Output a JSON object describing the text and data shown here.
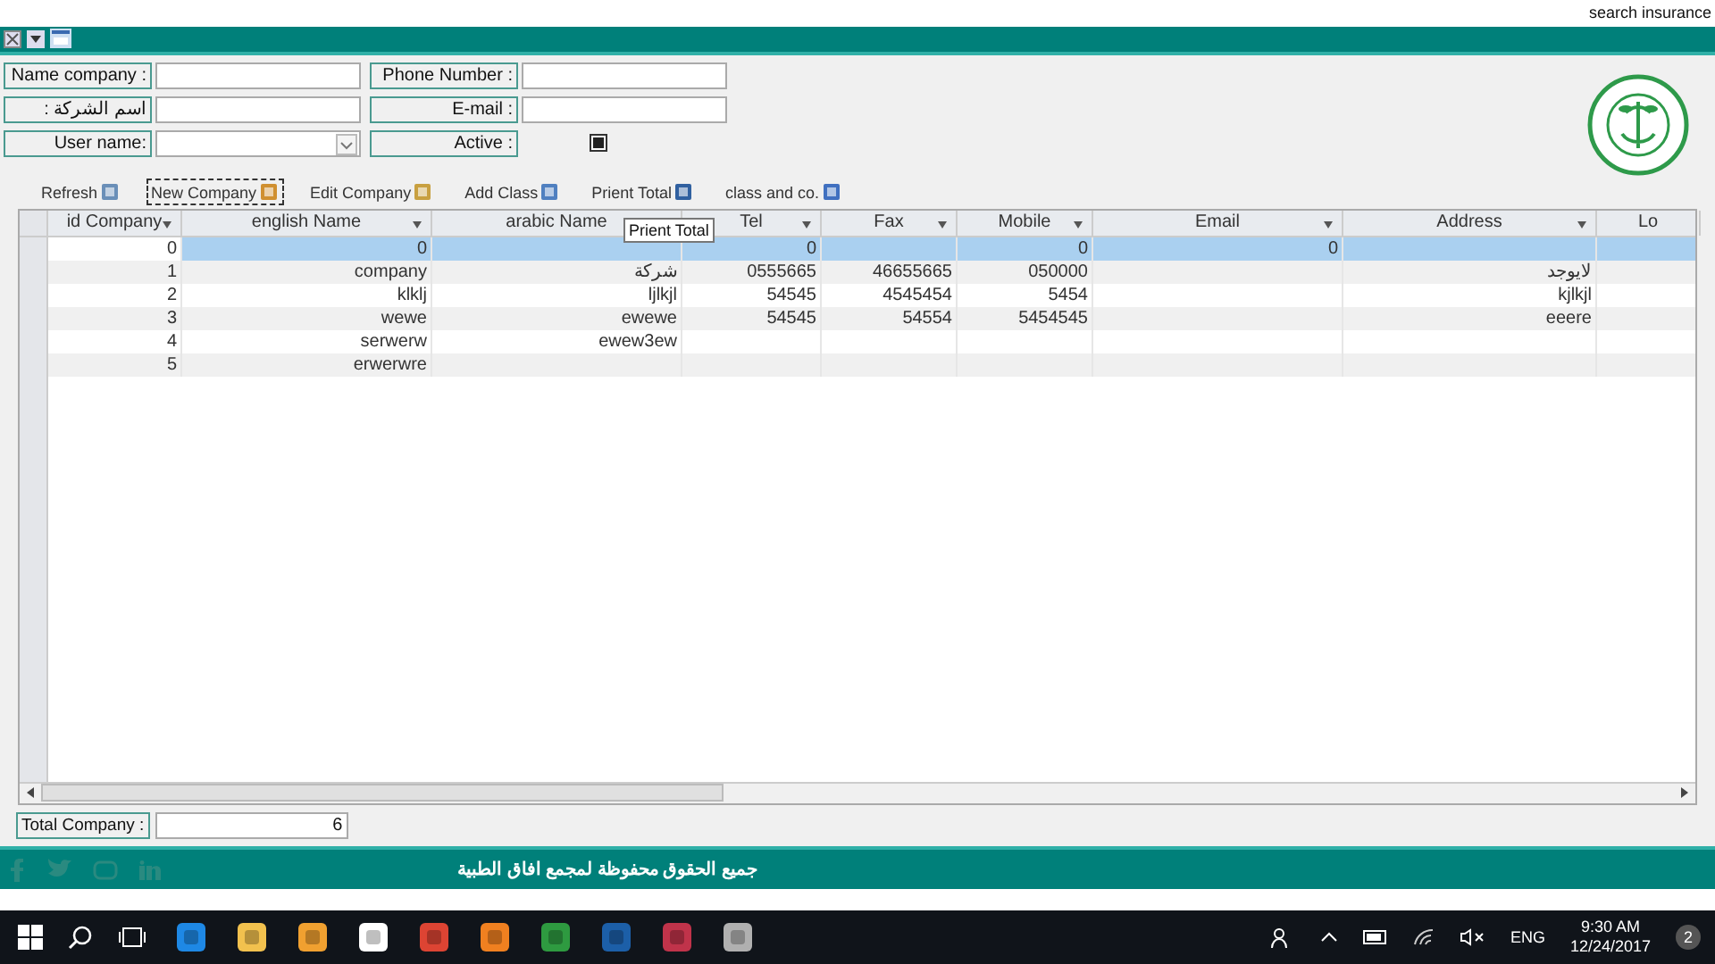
{
  "top_link": "search insurance",
  "form": {
    "fields": [
      {
        "label": "Name company :",
        "kind": "text"
      },
      {
        "label": "Phone Number :",
        "kind": "text"
      },
      {
        "label": ": اسم الشركة",
        "kind": "text"
      },
      {
        "label": "E-mail :",
        "kind": "text"
      },
      {
        "label": "User name:",
        "kind": "combo"
      },
      {
        "label": "Active :",
        "kind": "check",
        "checked": true
      }
    ]
  },
  "toolbar": [
    {
      "label": "Refresh",
      "focused": false
    },
    {
      "label": "New Company",
      "focused": true
    },
    {
      "label": "Edit Company",
      "focused": false
    },
    {
      "label": "Add Class",
      "focused": false
    },
    {
      "label": "Prient Total",
      "focused": false
    },
    {
      "label": "class and co.",
      "focused": false
    }
  ],
  "grid": {
    "columns": [
      {
        "label": "id Company",
        "menu": true
      },
      {
        "label": "english Name",
        "menu": true
      },
      {
        "label": "arabic Name"
      },
      {
        "label": "Tel",
        "menu": true
      },
      {
        "label": "Fax",
        "menu": true
      },
      {
        "label": "Mobile",
        "menu": true
      },
      {
        "label": "Email",
        "menu": true
      },
      {
        "label": "Address",
        "menu": true
      },
      {
        "label": "Lo"
      }
    ],
    "rows": [
      {
        "selected": true,
        "cells": [
          "0",
          "0",
          "",
          "0",
          "",
          "0",
          "0",
          "",
          ""
        ]
      },
      {
        "selected": false,
        "cells": [
          "1",
          "company",
          "شركة",
          "0555665",
          "46655665",
          "050000",
          "",
          "لايوجد",
          ""
        ]
      },
      {
        "selected": false,
        "cells": [
          "2",
          "klklj",
          "ljlkjl",
          "54545",
          "4545454",
          "5454",
          "",
          "kjlkjl",
          ""
        ]
      },
      {
        "selected": false,
        "cells": [
          "3",
          "wewe",
          "ewewe",
          "54545",
          "54554",
          "5454545",
          "",
          "eeere",
          ""
        ]
      },
      {
        "selected": false,
        "cells": [
          "4",
          "serwerw",
          "ewew3ew",
          "",
          "",
          "",
          "",
          "",
          ""
        ]
      },
      {
        "selected": false,
        "cells": [
          "5",
          "erwerwre",
          "",
          "",
          "",
          "",
          "",
          "",
          ""
        ]
      }
    ]
  },
  "tooltip": "Prient Total",
  "total": {
    "label": "Total Company :",
    "value": "6"
  },
  "footer": {
    "text": "جميع الحقوق محفوظة لمجمع افاق الطبية"
  },
  "taskbar": {
    "language": "ENG",
    "time": "9:30 AM",
    "date": "12/24/2017",
    "notifications": "2"
  }
}
